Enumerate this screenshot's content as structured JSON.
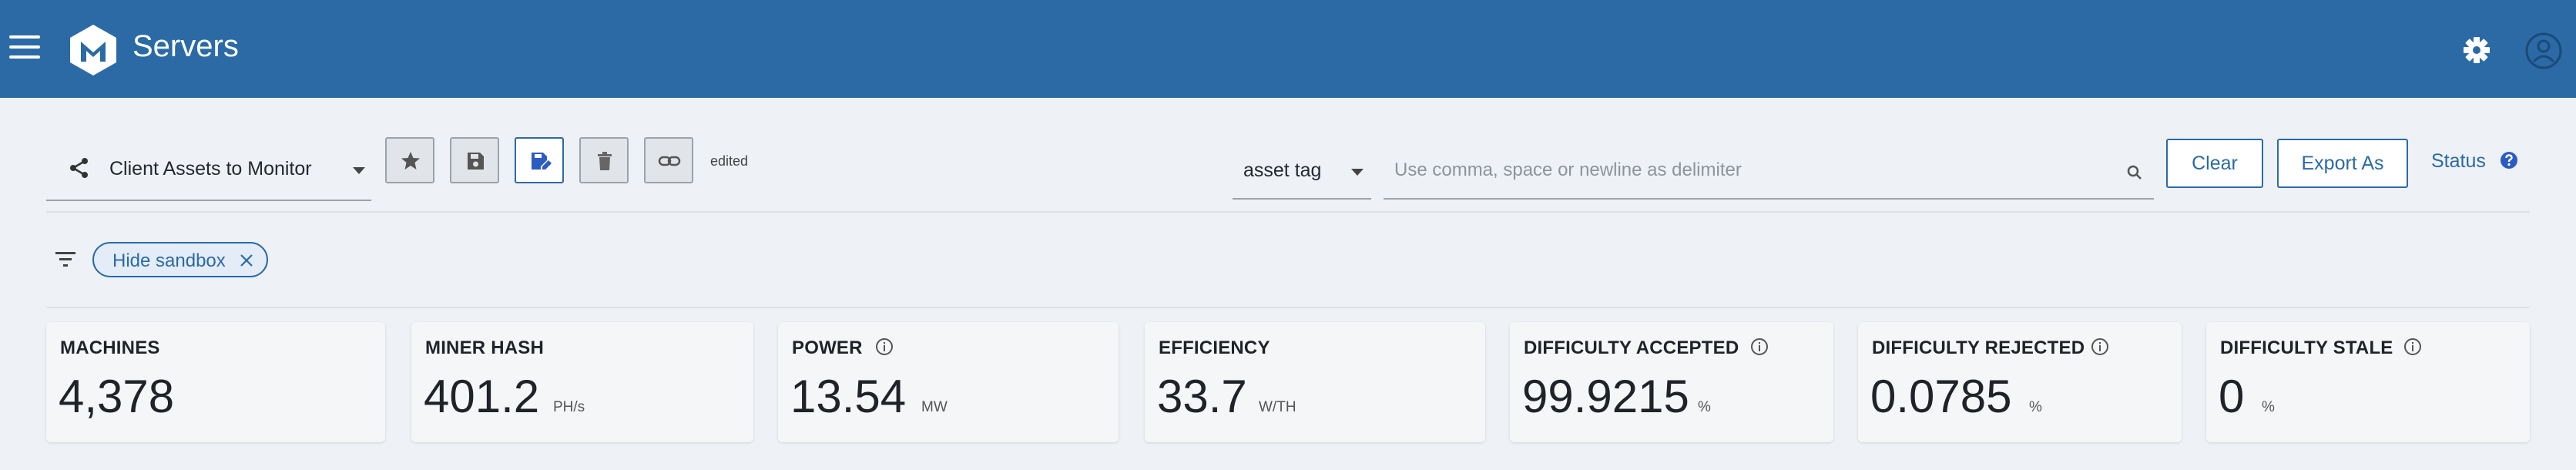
{
  "header": {
    "title": "Servers"
  },
  "toolbar": {
    "view_name": "Client Assets to Monitor",
    "edited_label": "edited",
    "search_field": "asset tag",
    "search_placeholder": "Use comma, space or newline as delimiter",
    "search_value": "",
    "clear_label": "Clear",
    "export_label": "Export As",
    "status_label": "Status"
  },
  "filters": {
    "chips": [
      {
        "label": "Hide sandbox"
      }
    ]
  },
  "metrics": [
    {
      "title": "MACHINES",
      "value": "4,378",
      "unit": "",
      "info": false
    },
    {
      "title": "MINER HASH",
      "value": "401.2",
      "unit": "PH/s",
      "info": false
    },
    {
      "title": "POWER",
      "value": "13.54",
      "unit": "MW",
      "info": true
    },
    {
      "title": "EFFICIENCY",
      "value": "33.7",
      "unit": "W/TH",
      "info": false
    },
    {
      "title": "DIFFICULTY ACCEPTED",
      "value": "99.9215",
      "unit": "%",
      "info": true
    },
    {
      "title": "DIFFICULTY REJECTED",
      "value": "0.0785",
      "unit": "%",
      "info": true
    },
    {
      "title": "DIFFICULTY STALE",
      "value": "0",
      "unit": "%",
      "info": true
    }
  ],
  "colors": {
    "header_bg": "#2b6aa5",
    "accent": "#2b6aa5",
    "page_bg": "#eef1f5"
  },
  "icons": [
    "menu-icon",
    "logo-icon",
    "gear-icon",
    "user-icon",
    "share-icon",
    "star-icon",
    "save-icon",
    "save-as-icon",
    "trash-icon",
    "link-icon",
    "search-icon",
    "help-icon",
    "filter-icon",
    "close-icon",
    "info-icon"
  ]
}
